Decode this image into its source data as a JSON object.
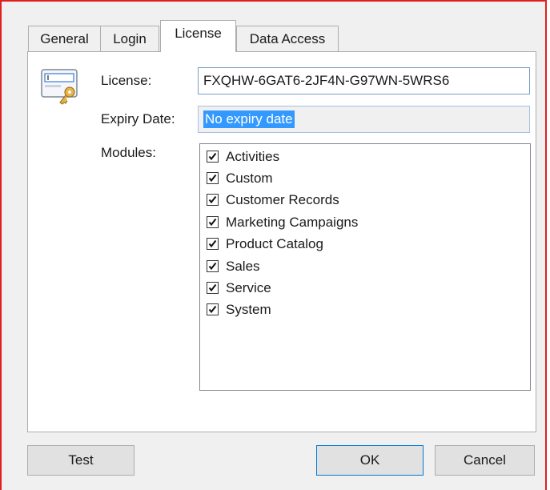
{
  "tabs": [
    {
      "label": "General"
    },
    {
      "label": "Login"
    },
    {
      "label": "License"
    },
    {
      "label": "Data Access"
    }
  ],
  "license": {
    "label": "License:",
    "value": "FXQHW-6GAT6-2JF4N-G97WN-5WRS6"
  },
  "expiry": {
    "label": "Expiry Date:",
    "value": "No expiry date"
  },
  "modules": {
    "label": "Modules:",
    "items": [
      {
        "label": "Activities",
        "checked": true
      },
      {
        "label": "Custom",
        "checked": true
      },
      {
        "label": "Customer Records",
        "checked": true
      },
      {
        "label": "Marketing Campaigns",
        "checked": true
      },
      {
        "label": "Product Catalog",
        "checked": true
      },
      {
        "label": "Sales",
        "checked": true
      },
      {
        "label": "Service",
        "checked": true
      },
      {
        "label": "System",
        "checked": true
      }
    ]
  },
  "buttons": {
    "test": "Test",
    "ok": "OK",
    "cancel": "Cancel"
  },
  "colors": {
    "dialog_bg": "#f0f0f0",
    "frame_border": "#e02020",
    "selection": "#3399ff",
    "field_border": "#7a9cc8"
  },
  "icons": {
    "license_icon": "license-key-icon",
    "checkbox": "checkmark-icon"
  }
}
